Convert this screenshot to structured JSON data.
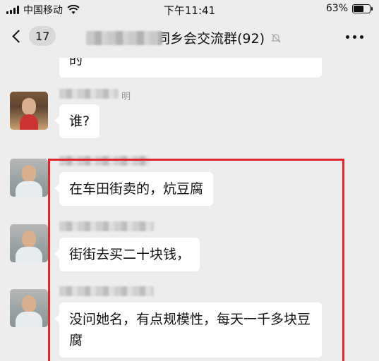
{
  "status_bar": {
    "carrier": "中国移动",
    "time": "下午11:41",
    "battery_percent": "63%",
    "battery_level": 0.63
  },
  "nav": {
    "back_count": "17",
    "title": "同乡会交流群(92)",
    "title_visible": "同乡会交流群(92)"
  },
  "messages": [
    {
      "sender_visible": "",
      "text": "的"
    },
    {
      "sender_visible": "明",
      "text": "谁?"
    },
    {
      "sender_visible": "",
      "text": "在车田街卖的，炕豆腐"
    },
    {
      "sender_visible": "",
      "text": "街街去买二十块钱，"
    },
    {
      "sender_visible": "",
      "text": "没问她名，有点规模性，每天一千多块豆腐"
    }
  ],
  "colors": {
    "background": "#ededed",
    "bubble": "#ffffff",
    "highlight_border": "#e0252b"
  }
}
